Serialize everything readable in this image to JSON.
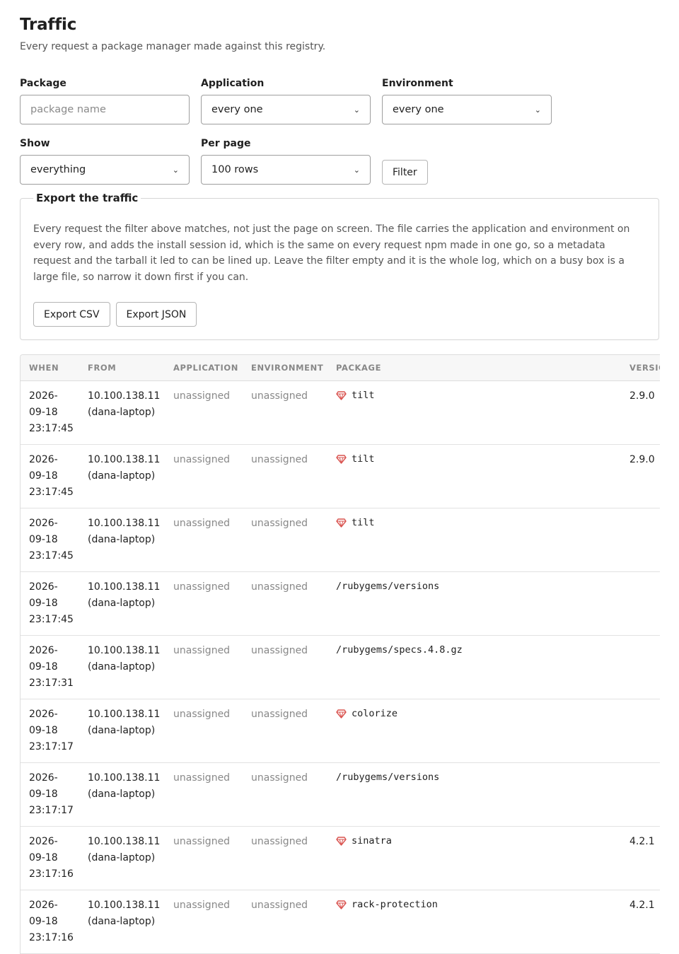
{
  "page": {
    "title": "Traffic",
    "subtitle": "Every request a package manager made against this registry."
  },
  "filters": {
    "package": {
      "label": "Package",
      "placeholder": "package name",
      "value": ""
    },
    "application": {
      "label": "Application",
      "value": "every one"
    },
    "environment": {
      "label": "Environment",
      "value": "every one"
    },
    "show": {
      "label": "Show",
      "value": "everything"
    },
    "per_page": {
      "label": "Per page",
      "value": "100 rows"
    },
    "filter_button": "Filter"
  },
  "export": {
    "legend": "Export the traffic",
    "description": "Every request the filter above matches, not just the page on screen. The file carries the application and environment on every row, and adds the install session id, which is the same on every request npm made in one go, so a metadata request and the tarball it led to can be lined up. Leave the filter empty and it is the whole log, which on a busy box is a large file, so narrow it down first if you can.",
    "csv_button": "Export CSV",
    "json_button": "Export JSON"
  },
  "table": {
    "columns": [
      "WHEN",
      "FROM",
      "APPLICATION",
      "ENVIRONMENT",
      "PACKAGE",
      "VERSIO"
    ],
    "rows": [
      {
        "date": "2026-",
        "date2": "09-18",
        "time": "23:17:45",
        "ip": "10.100.138.11",
        "host": "(dana-laptop)",
        "application": "unassigned",
        "environment": "unassigned",
        "package": "tilt",
        "gem": true,
        "version": "2.9.0"
      },
      {
        "date": "2026-",
        "date2": "09-18",
        "time": "23:17:45",
        "ip": "10.100.138.11",
        "host": "(dana-laptop)",
        "application": "unassigned",
        "environment": "unassigned",
        "package": "tilt",
        "gem": true,
        "version": "2.9.0"
      },
      {
        "date": "2026-",
        "date2": "09-18",
        "time": "23:17:45",
        "ip": "10.100.138.11",
        "host": "(dana-laptop)",
        "application": "unassigned",
        "environment": "unassigned",
        "package": "tilt",
        "gem": true,
        "version": ""
      },
      {
        "date": "2026-",
        "date2": "09-18",
        "time": "23:17:45",
        "ip": "10.100.138.11",
        "host": "(dana-laptop)",
        "application": "unassigned",
        "environment": "unassigned",
        "package": "/rubygems/versions",
        "gem": false,
        "version": ""
      },
      {
        "date": "2026-",
        "date2": "09-18",
        "time": "23:17:31",
        "ip": "10.100.138.11",
        "host": "(dana-laptop)",
        "application": "unassigned",
        "environment": "unassigned",
        "package": "/rubygems/specs.4.8.gz",
        "gem": false,
        "version": ""
      },
      {
        "date": "2026-",
        "date2": "09-18",
        "time": "23:17:17",
        "ip": "10.100.138.11",
        "host": "(dana-laptop)",
        "application": "unassigned",
        "environment": "unassigned",
        "package": "colorize",
        "gem": true,
        "version": ""
      },
      {
        "date": "2026-",
        "date2": "09-18",
        "time": "23:17:17",
        "ip": "10.100.138.11",
        "host": "(dana-laptop)",
        "application": "unassigned",
        "environment": "unassigned",
        "package": "/rubygems/versions",
        "gem": false,
        "version": ""
      },
      {
        "date": "2026-",
        "date2": "09-18",
        "time": "23:17:16",
        "ip": "10.100.138.11",
        "host": "(dana-laptop)",
        "application": "unassigned",
        "environment": "unassigned",
        "package": "sinatra",
        "gem": true,
        "version": "4.2.1"
      },
      {
        "date": "2026-",
        "date2": "09-18",
        "time": "23:17:16",
        "ip": "10.100.138.11",
        "host": "(dana-laptop)",
        "application": "unassigned",
        "environment": "unassigned",
        "package": "rack-protection",
        "gem": true,
        "version": "4.2.1"
      }
    ]
  },
  "icons": {
    "gem": "ruby-gem-icon",
    "select": "chevron-down-icon"
  },
  "colors": {
    "gem": "#d9534f",
    "muted": "#888888"
  }
}
